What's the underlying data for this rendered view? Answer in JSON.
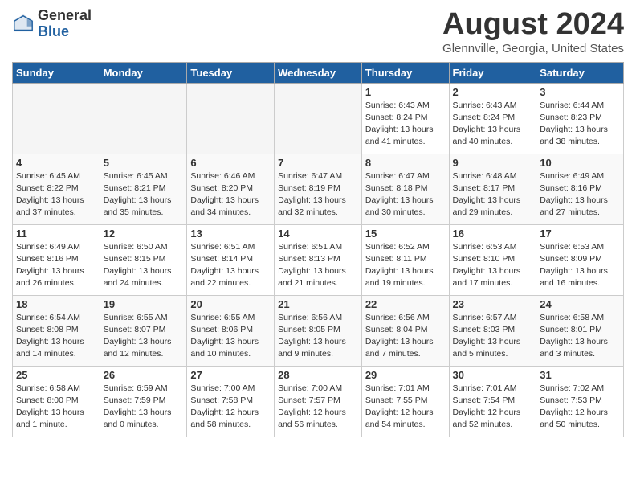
{
  "header": {
    "logo_general": "General",
    "logo_blue": "Blue",
    "month_title": "August 2024",
    "location": "Glennville, Georgia, United States"
  },
  "weekdays": [
    "Sunday",
    "Monday",
    "Tuesday",
    "Wednesday",
    "Thursday",
    "Friday",
    "Saturday"
  ],
  "weeks": [
    [
      {
        "day": "",
        "info": ""
      },
      {
        "day": "",
        "info": ""
      },
      {
        "day": "",
        "info": ""
      },
      {
        "day": "",
        "info": ""
      },
      {
        "day": "1",
        "info": "Sunrise: 6:43 AM\nSunset: 8:24 PM\nDaylight: 13 hours\nand 41 minutes."
      },
      {
        "day": "2",
        "info": "Sunrise: 6:43 AM\nSunset: 8:24 PM\nDaylight: 13 hours\nand 40 minutes."
      },
      {
        "day": "3",
        "info": "Sunrise: 6:44 AM\nSunset: 8:23 PM\nDaylight: 13 hours\nand 38 minutes."
      }
    ],
    [
      {
        "day": "4",
        "info": "Sunrise: 6:45 AM\nSunset: 8:22 PM\nDaylight: 13 hours\nand 37 minutes."
      },
      {
        "day": "5",
        "info": "Sunrise: 6:45 AM\nSunset: 8:21 PM\nDaylight: 13 hours\nand 35 minutes."
      },
      {
        "day": "6",
        "info": "Sunrise: 6:46 AM\nSunset: 8:20 PM\nDaylight: 13 hours\nand 34 minutes."
      },
      {
        "day": "7",
        "info": "Sunrise: 6:47 AM\nSunset: 8:19 PM\nDaylight: 13 hours\nand 32 minutes."
      },
      {
        "day": "8",
        "info": "Sunrise: 6:47 AM\nSunset: 8:18 PM\nDaylight: 13 hours\nand 30 minutes."
      },
      {
        "day": "9",
        "info": "Sunrise: 6:48 AM\nSunset: 8:17 PM\nDaylight: 13 hours\nand 29 minutes."
      },
      {
        "day": "10",
        "info": "Sunrise: 6:49 AM\nSunset: 8:16 PM\nDaylight: 13 hours\nand 27 minutes."
      }
    ],
    [
      {
        "day": "11",
        "info": "Sunrise: 6:49 AM\nSunset: 8:16 PM\nDaylight: 13 hours\nand 26 minutes."
      },
      {
        "day": "12",
        "info": "Sunrise: 6:50 AM\nSunset: 8:15 PM\nDaylight: 13 hours\nand 24 minutes."
      },
      {
        "day": "13",
        "info": "Sunrise: 6:51 AM\nSunset: 8:14 PM\nDaylight: 13 hours\nand 22 minutes."
      },
      {
        "day": "14",
        "info": "Sunrise: 6:51 AM\nSunset: 8:13 PM\nDaylight: 13 hours\nand 21 minutes."
      },
      {
        "day": "15",
        "info": "Sunrise: 6:52 AM\nSunset: 8:11 PM\nDaylight: 13 hours\nand 19 minutes."
      },
      {
        "day": "16",
        "info": "Sunrise: 6:53 AM\nSunset: 8:10 PM\nDaylight: 13 hours\nand 17 minutes."
      },
      {
        "day": "17",
        "info": "Sunrise: 6:53 AM\nSunset: 8:09 PM\nDaylight: 13 hours\nand 16 minutes."
      }
    ],
    [
      {
        "day": "18",
        "info": "Sunrise: 6:54 AM\nSunset: 8:08 PM\nDaylight: 13 hours\nand 14 minutes."
      },
      {
        "day": "19",
        "info": "Sunrise: 6:55 AM\nSunset: 8:07 PM\nDaylight: 13 hours\nand 12 minutes."
      },
      {
        "day": "20",
        "info": "Sunrise: 6:55 AM\nSunset: 8:06 PM\nDaylight: 13 hours\nand 10 minutes."
      },
      {
        "day": "21",
        "info": "Sunrise: 6:56 AM\nSunset: 8:05 PM\nDaylight: 13 hours\nand 9 minutes."
      },
      {
        "day": "22",
        "info": "Sunrise: 6:56 AM\nSunset: 8:04 PM\nDaylight: 13 hours\nand 7 minutes."
      },
      {
        "day": "23",
        "info": "Sunrise: 6:57 AM\nSunset: 8:03 PM\nDaylight: 13 hours\nand 5 minutes."
      },
      {
        "day": "24",
        "info": "Sunrise: 6:58 AM\nSunset: 8:01 PM\nDaylight: 13 hours\nand 3 minutes."
      }
    ],
    [
      {
        "day": "25",
        "info": "Sunrise: 6:58 AM\nSunset: 8:00 PM\nDaylight: 13 hours\nand 1 minute."
      },
      {
        "day": "26",
        "info": "Sunrise: 6:59 AM\nSunset: 7:59 PM\nDaylight: 13 hours\nand 0 minutes."
      },
      {
        "day": "27",
        "info": "Sunrise: 7:00 AM\nSunset: 7:58 PM\nDaylight: 12 hours\nand 58 minutes."
      },
      {
        "day": "28",
        "info": "Sunrise: 7:00 AM\nSunset: 7:57 PM\nDaylight: 12 hours\nand 56 minutes."
      },
      {
        "day": "29",
        "info": "Sunrise: 7:01 AM\nSunset: 7:55 PM\nDaylight: 12 hours\nand 54 minutes."
      },
      {
        "day": "30",
        "info": "Sunrise: 7:01 AM\nSunset: 7:54 PM\nDaylight: 12 hours\nand 52 minutes."
      },
      {
        "day": "31",
        "info": "Sunrise: 7:02 AM\nSunset: 7:53 PM\nDaylight: 12 hours\nand 50 minutes."
      }
    ]
  ]
}
